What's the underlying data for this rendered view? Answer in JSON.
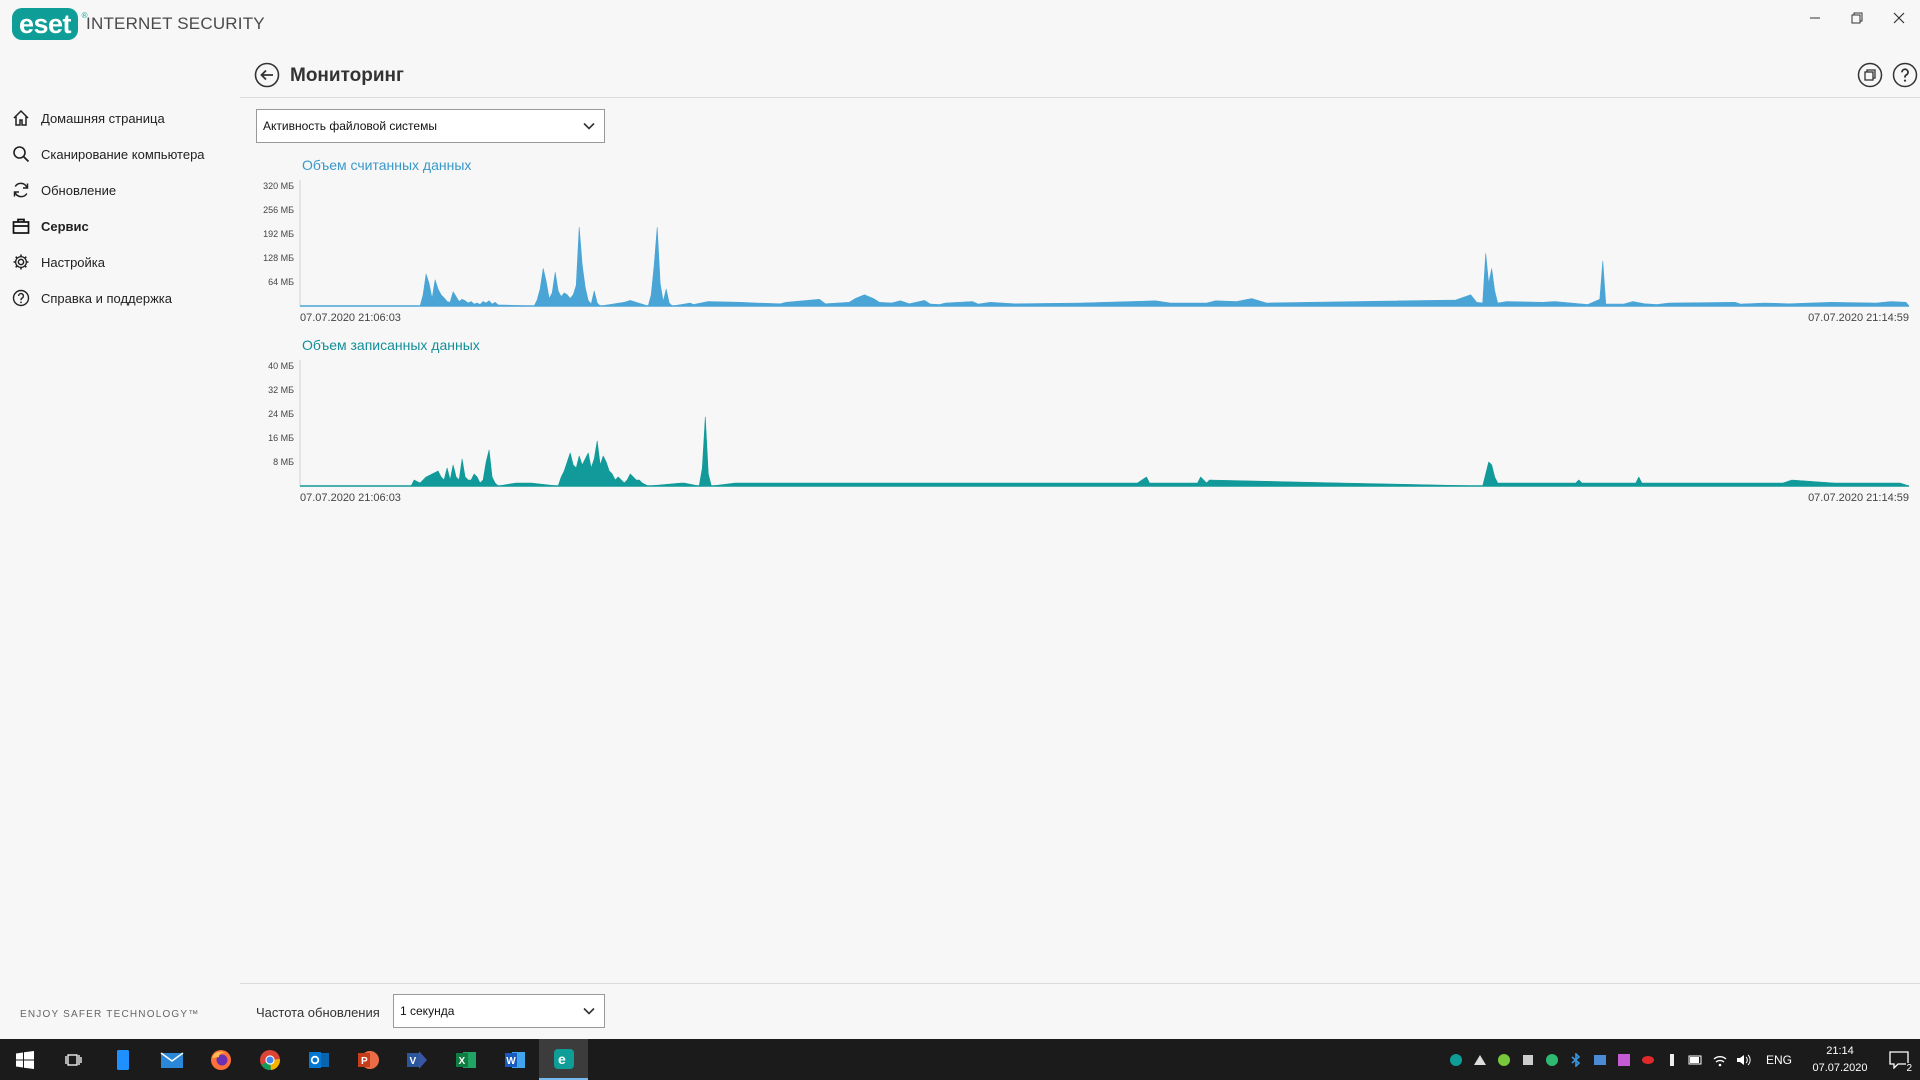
{
  "app": {
    "logo_text": "eset",
    "product_name": "INTERNET SECURITY",
    "tagline": "ENJOY SAFER TECHNOLOGY™"
  },
  "window_controls": [
    {
      "name": "minimize",
      "glyph": "─"
    },
    {
      "name": "restore",
      "glyph": "❐"
    },
    {
      "name": "close",
      "glyph": "✕"
    }
  ],
  "sidebar": {
    "items": [
      {
        "label": "Домашняя страница",
        "icon": "home-icon",
        "active": false
      },
      {
        "label": "Сканирование компьютера",
        "icon": "search-icon",
        "active": false
      },
      {
        "label": "Обновление",
        "icon": "refresh-icon",
        "active": false
      },
      {
        "label": "Сервис",
        "icon": "briefcase-icon",
        "active": true
      },
      {
        "label": "Настройка",
        "icon": "gear-icon",
        "active": false
      },
      {
        "label": "Справка и поддержка",
        "icon": "help-icon",
        "active": false
      }
    ]
  },
  "header": {
    "title": "Мониторинг"
  },
  "view_selector": {
    "value": "Активность файловой системы"
  },
  "footer": {
    "refresh_label": "Частота обновления",
    "refresh_value": "1 секунда"
  },
  "colors": {
    "read": "#4aa5d6",
    "write": "#119a99",
    "accent": "#0e9e97"
  },
  "chart_data": [
    {
      "type": "area",
      "title": "Объем считанных данных",
      "y_ticks": [
        "320 МБ",
        "256 МБ",
        "192 МБ",
        "128 МБ",
        "64 МБ"
      ],
      "y_tick_values": [
        320,
        256,
        192,
        128,
        64
      ],
      "ylim": [
        0,
        320
      ],
      "x_start": "07.07.2020 21:06:03",
      "x_end": "07.07.2020 21:14:59",
      "duration_s": 536,
      "grid": false,
      "series": [
        {
          "values": [
            [
              40,
              0
            ],
            [
              41,
              30
            ],
            [
              42,
              85
            ],
            [
              43,
              60
            ],
            [
              44,
              20
            ],
            [
              45,
              70
            ],
            [
              46,
              45
            ],
            [
              47,
              30
            ],
            [
              48,
              22
            ],
            [
              49,
              12
            ],
            [
              50,
              10
            ],
            [
              51,
              38
            ],
            [
              52,
              25
            ],
            [
              53,
              12
            ],
            [
              54,
              18
            ],
            [
              55,
              14
            ],
            [
              56,
              8
            ],
            [
              57,
              12
            ],
            [
              58,
              5
            ],
            [
              59,
              8
            ],
            [
              60,
              4
            ],
            [
              61,
              12
            ],
            [
              62,
              8
            ],
            [
              63,
              14
            ],
            [
              64,
              5
            ],
            [
              65,
              10
            ],
            [
              66,
              3
            ],
            [
              78,
              0
            ],
            [
              79,
              16
            ],
            [
              80,
              45
            ],
            [
              81,
              100
            ],
            [
              82,
              65
            ],
            [
              83,
              20
            ],
            [
              84,
              35
            ],
            [
              85,
              90
            ],
            [
              86,
              40
            ],
            [
              87,
              25
            ],
            [
              88,
              35
            ],
            [
              89,
              30
            ],
            [
              90,
              20
            ],
            [
              91,
              30
            ],
            [
              92,
              55
            ],
            [
              93,
              210
            ],
            [
              94,
              110
            ],
            [
              95,
              50
            ],
            [
              96,
              15
            ],
            [
              97,
              5
            ],
            [
              98,
              40
            ],
            [
              99,
              8
            ],
            [
              100,
              0
            ],
            [
              108,
              10
            ],
            [
              110,
              15
            ],
            [
              116,
              0
            ],
            [
              117,
              30
            ],
            [
              118,
              110
            ],
            [
              119,
              210
            ],
            [
              120,
              60
            ],
            [
              121,
              12
            ],
            [
              122,
              45
            ],
            [
              123,
              8
            ],
            [
              124,
              0
            ],
            [
              130,
              8
            ],
            [
              131,
              4
            ],
            [
              136,
              12
            ],
            [
              147,
              10
            ],
            [
              152,
              8
            ],
            [
              160,
              6
            ],
            [
              162,
              10
            ],
            [
              173,
              18
            ],
            [
              175,
              6
            ],
            [
              183,
              10
            ],
            [
              185,
              20
            ],
            [
              188,
              30
            ],
            [
              191,
              20
            ],
            [
              193,
              10
            ],
            [
              197,
              8
            ],
            [
              200,
              14
            ],
            [
              203,
              6
            ],
            [
              208,
              15
            ],
            [
              210,
              5
            ],
            [
              213,
              4
            ],
            [
              215,
              8
            ],
            [
              224,
              12
            ],
            [
              226,
              5
            ],
            [
              230,
              10
            ],
            [
              238,
              6
            ],
            [
              260,
              8
            ],
            [
              285,
              14
            ],
            [
              290,
              8
            ],
            [
              302,
              8
            ],
            [
              305,
              14
            ],
            [
              312,
              12
            ],
            [
              317,
              20
            ],
            [
              322,
              8
            ],
            [
              385,
              16
            ],
            [
              390,
              30
            ],
            [
              392,
              10
            ],
            [
              394,
              8
            ],
            [
              395,
              140
            ],
            [
              396,
              60
            ],
            [
              397,
              100
            ],
            [
              398,
              40
            ],
            [
              399,
              8
            ],
            [
              402,
              12
            ],
            [
              414,
              10
            ],
            [
              418,
              12
            ],
            [
              429,
              4
            ],
            [
              433,
              18
            ],
            [
              434,
              120
            ],
            [
              435,
              5
            ],
            [
              441,
              5
            ],
            [
              444,
              12
            ],
            [
              448,
              6
            ],
            [
              452,
              4
            ],
            [
              456,
              8
            ],
            [
              478,
              10
            ],
            [
              480,
              5
            ],
            [
              488,
              8
            ],
            [
              496,
              6
            ],
            [
              510,
              10
            ],
            [
              525,
              8
            ],
            [
              530,
              12
            ],
            [
              535,
              10
            ]
          ]
        }
      ]
    },
    {
      "type": "area",
      "title": "Объем записанных данных",
      "y_ticks": [
        "40 МБ",
        "32 МБ",
        "24 МБ",
        "16 МБ",
        "8 МБ"
      ],
      "y_tick_values": [
        40,
        32,
        24,
        16,
        8
      ],
      "ylim": [
        0,
        40
      ],
      "x_start": "07.07.2020 21:06:03",
      "x_end": "07.07.2020 21:14:59",
      "duration_s": 536,
      "grid": false,
      "series": [
        {
          "values": [
            [
              37,
              0
            ],
            [
              38,
              2
            ],
            [
              40,
              1
            ],
            [
              42,
              3
            ],
            [
              44,
              4
            ],
            [
              46,
              5
            ],
            [
              47,
              3
            ],
            [
              48,
              2
            ],
            [
              49,
              6
            ],
            [
              50,
              2
            ],
            [
              51,
              7
            ],
            [
              52,
              3
            ],
            [
              53,
              2
            ],
            [
              54,
              9
            ],
            [
              55,
              3
            ],
            [
              56,
              2
            ],
            [
              57,
              2
            ],
            [
              58,
              4
            ],
            [
              59,
              3
            ],
            [
              60,
              1
            ],
            [
              61,
              2
            ],
            [
              62,
              8
            ],
            [
              63,
              12
            ],
            [
              64,
              3
            ],
            [
              65,
              1
            ],
            [
              66,
              0
            ],
            [
              72,
              1
            ],
            [
              77,
              1
            ],
            [
              86,
              0
            ],
            [
              87,
              3
            ],
            [
              88,
              5
            ],
            [
              89,
              8
            ],
            [
              90,
              11
            ],
            [
              91,
              7
            ],
            [
              92,
              6
            ],
            [
              93,
              10
            ],
            [
              94,
              7
            ],
            [
              95,
              9
            ],
            [
              96,
              11
            ],
            [
              97,
              6
            ],
            [
              98,
              9
            ],
            [
              99,
              15
            ],
            [
              100,
              7
            ],
            [
              101,
              10
            ],
            [
              102,
              8
            ],
            [
              103,
              5
            ],
            [
              104,
              4
            ],
            [
              105,
              2
            ],
            [
              106,
              3
            ],
            [
              107,
              2
            ],
            [
              108,
              1
            ],
            [
              109,
              2
            ],
            [
              110,
              4
            ],
            [
              111,
              3
            ],
            [
              112,
              2
            ],
            [
              113,
              2
            ],
            [
              114,
              1
            ],
            [
              116,
              0
            ],
            [
              127,
              1
            ],
            [
              128,
              1
            ],
            [
              133,
              0
            ],
            [
              134,
              6
            ],
            [
              135,
              23
            ],
            [
              136,
              4
            ],
            [
              137,
              0
            ],
            [
              145,
              1
            ],
            [
              150,
              1
            ],
            [
              160,
              1
            ],
            [
              168,
              1
            ],
            [
              177,
              1
            ],
            [
              182,
              1
            ],
            [
              188,
              1
            ],
            [
              200,
              1
            ],
            [
              222,
              1
            ],
            [
              260,
              1
            ],
            [
              266,
              1
            ],
            [
              279,
              1
            ],
            [
              282,
              3
            ],
            [
              283,
              1
            ],
            [
              299,
              1
            ],
            [
              300,
              3
            ],
            [
              302,
              1
            ],
            [
              303,
              2
            ],
            [
              347,
              1
            ],
            [
              394,
              0
            ],
            [
              395,
              4
            ],
            [
              396,
              8
            ],
            [
              397,
              7
            ],
            [
              398,
              3
            ],
            [
              399,
              1
            ],
            [
              402,
              1
            ],
            [
              404,
              1
            ],
            [
              425,
              1
            ],
            [
              426,
              2
            ],
            [
              427,
              1
            ],
            [
              431,
              1
            ],
            [
              445,
              1
            ],
            [
              446,
              3
            ],
            [
              447,
              1
            ],
            [
              452,
              1
            ],
            [
              456,
              1
            ],
            [
              468,
              1
            ],
            [
              477,
              1
            ],
            [
              494,
              1
            ],
            [
              497,
              2
            ],
            [
              511,
              1
            ],
            [
              533,
              1
            ]
          ]
        }
      ]
    }
  ],
  "taskbar": {
    "apps": [
      {
        "name": "start",
        "icon": "windows-icon"
      },
      {
        "name": "task-view",
        "icon": "task-view-icon"
      },
      {
        "name": "phone",
        "icon": "phone-icon"
      },
      {
        "name": "mail",
        "icon": "mail-icon"
      },
      {
        "name": "firefox",
        "icon": "firefox-icon"
      },
      {
        "name": "chrome",
        "icon": "chrome-icon"
      },
      {
        "name": "outlook",
        "icon": "outlook-icon"
      },
      {
        "name": "powerpoint",
        "icon": "powerpoint-icon"
      },
      {
        "name": "visio",
        "icon": "visio-icon"
      },
      {
        "name": "excel",
        "icon": "excel-icon"
      },
      {
        "name": "word",
        "icon": "word-icon"
      },
      {
        "name": "eset",
        "icon": "eset-icon",
        "active": true
      }
    ],
    "lang": "ENG",
    "time": "21:14",
    "date": "07.07.2020",
    "notifications": "2"
  }
}
